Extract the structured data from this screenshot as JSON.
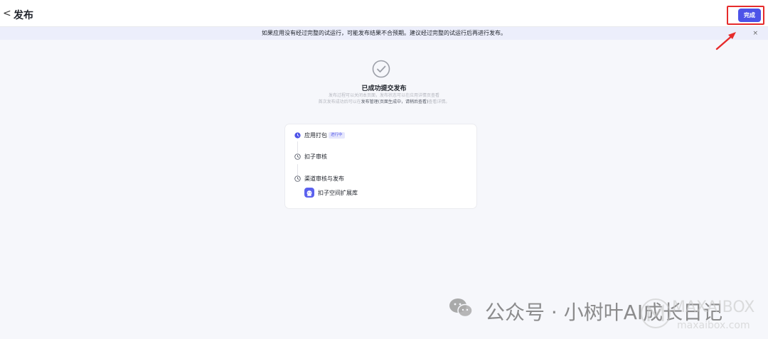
{
  "header": {
    "back_glyph": "<",
    "title": "发布",
    "done_label": "完成"
  },
  "notice": {
    "text": "如果应用没有经过完整的试运行，可能发布结果不合预期。建议经过完整的试运行后再进行发布。",
    "close_glyph": "×"
  },
  "success": {
    "title": "已成功提交发布",
    "line1": "发布过程可以关闭本页面，发布状态可以在应用详情页查看",
    "line2_prefix": "首次发布成功后可以在",
    "line2_strong": "发布管理(页面生成中，请稍后查看)",
    "line2_suffix": "查看详情。"
  },
  "steps": [
    {
      "label": "应用打包",
      "status": "in-progress",
      "badge": "进行中",
      "icon": "progress-clock-icon"
    },
    {
      "label": "扣子审核",
      "status": "pending",
      "icon": "clock-icon"
    },
    {
      "label": "渠道审核与发布",
      "status": "pending",
      "icon": "clock-icon"
    }
  ],
  "channel": {
    "label": "扣子空间扩展库",
    "icon": "coze-space-icon"
  },
  "watermark": {
    "account": "公众号 · 小树叶AI成长日记",
    "brand": "MAXAIBOX",
    "url": "maxaibox.com"
  },
  "colors": {
    "accent": "#4d53e8",
    "annotation_red": "#e62b2b",
    "notice_bg": "#eceefb",
    "page_bg": "#f6f7fb"
  }
}
